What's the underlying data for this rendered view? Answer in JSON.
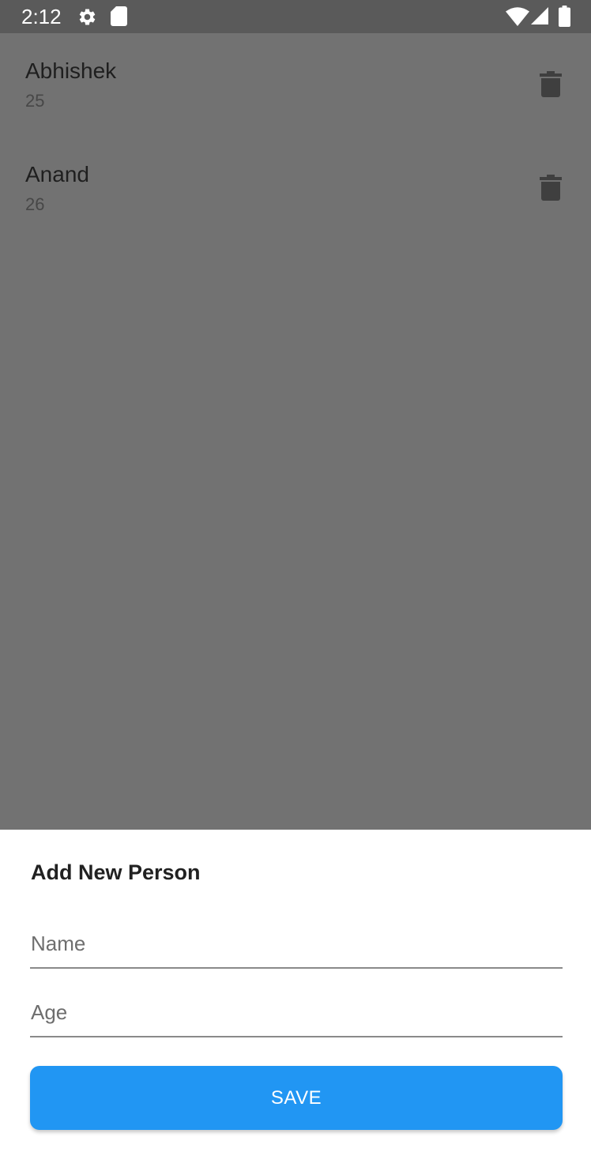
{
  "status_bar": {
    "time": "2:12",
    "icons": [
      "settings-icon",
      "sd-card-icon",
      "wifi-icon",
      "signal-icon",
      "battery-icon"
    ]
  },
  "people": [
    {
      "name": "Abhishek",
      "age": "25"
    },
    {
      "name": "Anand",
      "age": "26"
    }
  ],
  "sheet": {
    "title": "Add New Person",
    "name_placeholder": "Name",
    "age_placeholder": "Age",
    "save_label": "SAVE"
  },
  "colors": {
    "scrim": "#727272",
    "status_bar": "#5a5a5a",
    "accent": "#2196f3",
    "delete_icon": "#3f3f3f"
  }
}
